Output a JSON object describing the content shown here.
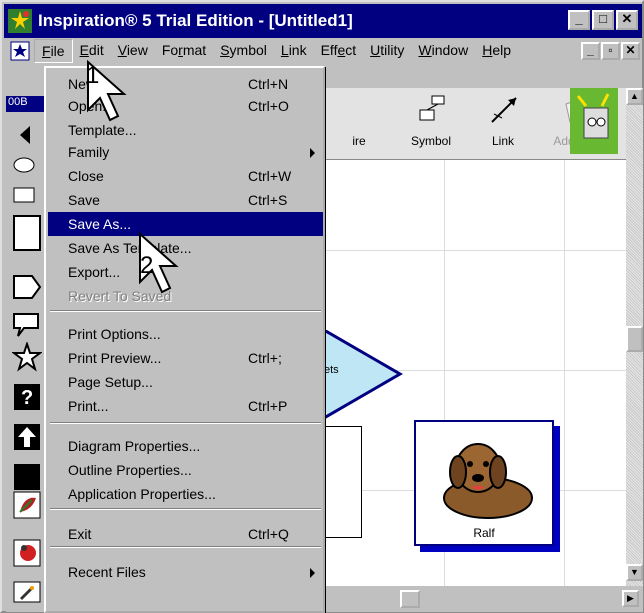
{
  "window": {
    "title": "Inspiration® 5 Trial Edition - [Untitled1]"
  },
  "title_buttons": {
    "minimize": "_",
    "maximize": "□",
    "close": "✕"
  },
  "mdi_buttons": {
    "minimize": "_",
    "restore": "▫",
    "close": "✕"
  },
  "menubar": {
    "items": [
      {
        "label": "File",
        "ul": "F",
        "rest": "ile"
      },
      {
        "label": "Edit",
        "ul": "E",
        "rest": "dit"
      },
      {
        "label": "View",
        "ul": "V",
        "rest": "iew"
      },
      {
        "label": "Format",
        "pre": "Fo",
        "ul": "r",
        "rest": "mat"
      },
      {
        "label": "Symbol",
        "ul": "S",
        "rest": "ymbol"
      },
      {
        "label": "Link",
        "ul": "L",
        "rest": "ink"
      },
      {
        "label": "Effect",
        "pre": "Eff",
        "ul": "e",
        "rest": "ct"
      },
      {
        "label": "Utility",
        "ul": "U",
        "rest": "tility"
      },
      {
        "label": "Window",
        "ul": "W",
        "rest": "indow"
      },
      {
        "label": "Help",
        "ul": "H",
        "rest": "elp"
      }
    ]
  },
  "file_menu": {
    "items": [
      {
        "label": "New",
        "shortcut": "Ctrl+N"
      },
      {
        "label": "Open...",
        "shortcut": "Ctrl+O"
      },
      {
        "label": "Template...",
        "shortcut": ""
      },
      {
        "label": "Family",
        "shortcut": "",
        "submenu": true
      },
      {
        "label": "Close",
        "shortcut": "Ctrl+W"
      },
      {
        "label": "Save",
        "shortcut": "Ctrl+S"
      },
      {
        "label": "Save As...",
        "shortcut": "",
        "selected": true
      },
      {
        "label": "Save As Template...",
        "shortcut": ""
      },
      {
        "label": "Export...",
        "shortcut": ""
      },
      {
        "label": "Revert To Saved",
        "shortcut": "",
        "disabled": true
      },
      {
        "label": "Print Options...",
        "shortcut": ""
      },
      {
        "label": "Print Preview...",
        "shortcut": "Ctrl+;"
      },
      {
        "label": "Page Setup...",
        "shortcut": ""
      },
      {
        "label": "Print...",
        "shortcut": "Ctrl+P"
      },
      {
        "label": "Diagram Properties...",
        "shortcut": ""
      },
      {
        "label": "Outline Properties...",
        "shortcut": ""
      },
      {
        "label": "Application Properties...",
        "shortcut": ""
      },
      {
        "label": "Exit",
        "shortcut": "Ctrl+Q"
      },
      {
        "label": "Recent Files",
        "shortcut": "",
        "submenu": true
      }
    ]
  },
  "toolbar": {
    "buttons": [
      {
        "label": "ire"
      },
      {
        "label": "Symbol"
      },
      {
        "label": "Link"
      },
      {
        "label": "Add Not"
      }
    ]
  },
  "palette": {
    "label": "00B"
  },
  "canvas": {
    "shape_text": "ets",
    "image_caption": "Ralf"
  },
  "callouts": {
    "step1": "1",
    "step2": "2"
  },
  "colors": {
    "title_bar": "#000080",
    "selection": "#000080",
    "triangle": "#bfe6f5"
  }
}
